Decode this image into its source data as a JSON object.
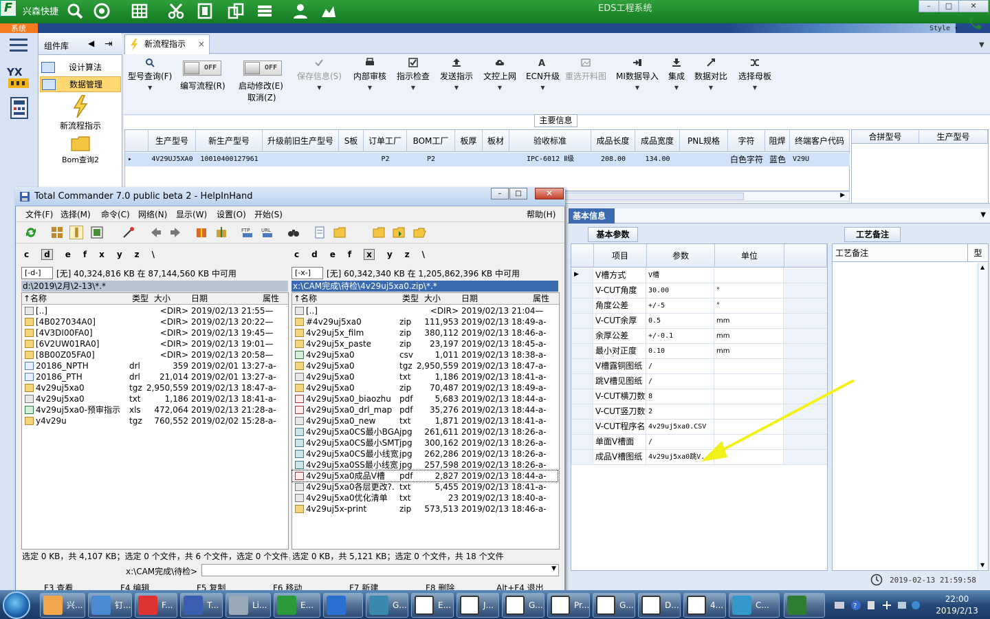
{
  "app": {
    "name": "兴森快捷",
    "title": "EDS工程系统",
    "system_tab": "系统",
    "style_label": "Style ▾"
  },
  "window_buttons": [
    "–",
    "□",
    "✕"
  ],
  "nav": {
    "comp_lib": "组件库",
    "items": [
      "设计算法",
      "数据管理"
    ],
    "big_items": [
      "新流程指示",
      "Bom查询2"
    ]
  },
  "doc_tab": {
    "label": "新流程指示",
    "close": "×"
  },
  "ribbon": {
    "type_query": "型号查询(F)",
    "write_flow": "编写流程(R)",
    "write_flow_state": "OFF",
    "start_edit": "启动修改(E)",
    "start_edit_state": "OFF",
    "cancel": "取消(Z)",
    "save_info": "保存信息(S)",
    "internal_review": "内部审核",
    "indicate_check": "指示检查",
    "send_indicate": "发送指示",
    "upload_doc": "文控上网",
    "ecn_upgrade": "ECN升级",
    "reselect_material": "重选开料图",
    "mi_import": "MI数据导入",
    "integrate": "集成",
    "data_compare": "数据对比",
    "select_mother": "选择母板"
  },
  "main_info": {
    "label": "主要信息",
    "headers": [
      "生产型号",
      "新生产型号",
      "升级前旧生产型号",
      "S板",
      "订单工厂",
      "BOM工厂",
      "板厚",
      "板材",
      "验收标准",
      "成品长度",
      "成品宽度",
      "PNL规格",
      "字符",
      "阻焊",
      "终端客户代码"
    ],
    "row": [
      "4V29UJ5XA0",
      "10010400127961",
      "",
      "",
      "P2",
      "P2",
      "",
      "",
      "IPC-6012 Ⅱ级",
      "208.00",
      "134.00",
      "",
      "白色字符",
      "蓝色",
      "V29U"
    ],
    "side_headers": [
      "合拼型号",
      "生产型号"
    ]
  },
  "basic_info": {
    "tab": "基本信息",
    "param_tab": "基本参数",
    "headers": [
      "项目",
      "参数",
      "单位"
    ],
    "rows": [
      {
        "item": "V槽方式",
        "value": "V槽",
        "unit": ""
      },
      {
        "item": "V-CUT角度",
        "value": "30.00",
        "unit": "°"
      },
      {
        "item": "角度公差",
        "value": "+/-5",
        "unit": "°"
      },
      {
        "item": "V-CUT余厚",
        "value": "0.5",
        "unit": "mm"
      },
      {
        "item": "余厚公差",
        "value": "+/-0.1",
        "unit": "mm"
      },
      {
        "item": "最小对正度",
        "value": "0.10",
        "unit": "mm"
      },
      {
        "item": "V槽露铜图纸",
        "value": "/",
        "unit": ""
      },
      {
        "item": "跳V槽见图纸",
        "value": "/",
        "unit": ""
      },
      {
        "item": "V-CUT横刀数",
        "value": "8",
        "unit": ""
      },
      {
        "item": "V-CUT竖刀数",
        "value": "2",
        "unit": ""
      },
      {
        "item": "V-CUT程序名",
        "value": "4v29uj5xa0.CSV",
        "unit": ""
      },
      {
        "item": "单面V槽面",
        "value": "/",
        "unit": ""
      },
      {
        "item": "成品V槽图纸",
        "value": "4v29uj5xa0跳V...",
        "unit": ""
      }
    ],
    "craft_tab": "工艺备注",
    "craft_header": "工艺备注",
    "type_header": "型",
    "datetime": "2019-02-13 21:59:58"
  },
  "tc": {
    "title": "Total Commander 7.0 public beta 2 - HelpInHand",
    "menu": [
      "文件(F)",
      "选择(M)",
      "命令(C)",
      "网络(N)",
      "显示(W)",
      "设置(O)",
      "开始(S)"
    ],
    "help": "帮助(H)",
    "left": {
      "drives": [
        "c",
        "d",
        "e",
        "f",
        "x",
        "y",
        "z",
        "\\"
      ],
      "drive_sel": "[-d-]",
      "info": "[无] 40,324,816 KB 在 87,144,560 KB 中可用",
      "path": "d:\\2019\\2月\\2-13\\*.*",
      "headers": [
        "↑名称",
        "类型",
        "大小",
        "日期",
        "属性"
      ],
      "files": [
        {
          "n": "[..]",
          "t": "",
          "s": "<DIR>",
          "d": "2019/02/13 21:55—",
          "k": "u"
        },
        {
          "n": "[4B027034A0]",
          "t": "",
          "s": "<DIR>",
          "d": "2019/02/13 20:22—",
          "k": "f"
        },
        {
          "n": "[4V3DI00FA0]",
          "t": "",
          "s": "<DIR>",
          "d": "2019/02/13 19:45—",
          "k": "f"
        },
        {
          "n": "[6V2UW01RA0]",
          "t": "",
          "s": "<DIR>",
          "d": "2019/02/13 19:01—",
          "k": "f"
        },
        {
          "n": "[8B00Z05FA0]",
          "t": "",
          "s": "<DIR>",
          "d": "2019/02/13 20:58—",
          "k": "f"
        },
        {
          "n": "20186_NPTH",
          "t": "drl",
          "s": "359",
          "d": "2019/02/01 13:27-a-",
          "k": "d"
        },
        {
          "n": "20186_PTH",
          "t": "drl",
          "s": "21,014",
          "d": "2019/02/01 13:27-a-",
          "k": "d"
        },
        {
          "n": "4v29uj5xa0",
          "t": "tgz",
          "s": "2,950,559",
          "d": "2019/02/13 18:47-a-",
          "k": "f"
        },
        {
          "n": "4v29uj5xa0",
          "t": "txt",
          "s": "1,186",
          "d": "2019/02/13 18:41-a-",
          "k": "u"
        },
        {
          "n": "4v29uj5xa0-预审指示",
          "t": "xls",
          "s": "472,064",
          "d": "2019/02/13 21:28-a-",
          "k": "x"
        },
        {
          "n": "y4v29u",
          "t": "tgz",
          "s": "760,552",
          "d": "2019/02/02 15:28-a-",
          "k": "f"
        }
      ]
    },
    "right": {
      "drives": [
        "c",
        "d",
        "e",
        "f",
        "x",
        "y",
        "z",
        "\\"
      ],
      "drive_sel": "[-x-]",
      "info": "[无] 60,342,340 KB 在 1,205,862,396 KB 中可用",
      "path": "x:\\CAM完成\\待检\\4v29uj5xa0.zip\\*.*",
      "headers": [
        "↑名称",
        "类型",
        "大小",
        "日期",
        "属性"
      ],
      "files": [
        {
          "n": "[..]",
          "t": "",
          "s": "<DIR>",
          "d": "2019/02/13 21:04—",
          "k": "u"
        },
        {
          "n": "#4v29uj5xa0",
          "t": "zip",
          "s": "111,953",
          "d": "2019/02/13 18:49-a-",
          "k": "f"
        },
        {
          "n": "4v29uj5x_film",
          "t": "zip",
          "s": "380,112",
          "d": "2019/02/13 18:46-a-",
          "k": "f"
        },
        {
          "n": "4v29uj5x_paste",
          "t": "zip",
          "s": "23,197",
          "d": "2019/02/13 18:45-a-",
          "k": "f"
        },
        {
          "n": "4v29uj5xa0",
          "t": "csv",
          "s": "1,011",
          "d": "2019/02/13 18:38-a-",
          "k": "x"
        },
        {
          "n": "4v29uj5xa0",
          "t": "tgz",
          "s": "2,950,559",
          "d": "2019/02/13 18:47-a-",
          "k": "f"
        },
        {
          "n": "4v29uj5xa0",
          "t": "txt",
          "s": "1,186",
          "d": "2019/02/13 18:41-a-",
          "k": "u"
        },
        {
          "n": "4v29uj5xa0",
          "t": "zip",
          "s": "70,487",
          "d": "2019/02/13 18:49-a-",
          "k": "f"
        },
        {
          "n": "4v29uj5xa0_biaozhu",
          "t": "pdf",
          "s": "5,683",
          "d": "2019/02/13 18:44-a-",
          "k": "p"
        },
        {
          "n": "4v29uj5xa0_drl_map",
          "t": "pdf",
          "s": "35,276",
          "d": "2019/02/13 18:44-a-",
          "k": "p"
        },
        {
          "n": "4v29uj5xa0_new",
          "t": "txt",
          "s": "1,871",
          "d": "2019/02/13 18:41-a-",
          "k": "u"
        },
        {
          "n": "4v29uj5xa0CS最小BGA",
          "t": "jpg",
          "s": "261,611",
          "d": "2019/02/13 18:26-a-",
          "k": "j"
        },
        {
          "n": "4v29uj5xa0CS最小SMT",
          "t": "jpg",
          "s": "300,162",
          "d": "2019/02/13 18:26-a-",
          "k": "j"
        },
        {
          "n": "4v29uj5xa0CS最小线宽",
          "t": "jpg",
          "s": "262,286",
          "d": "2019/02/13 18:26-a-",
          "k": "j"
        },
        {
          "n": "4v29uj5xa0SS最小线宽",
          "t": "jpg",
          "s": "257,598",
          "d": "2019/02/13 18:26-a-",
          "k": "j"
        },
        {
          "n": "4v29uj5xa0成品V槽",
          "t": "pdf",
          "s": "2,827",
          "d": "2019/02/13 18:44-a-",
          "k": "p"
        },
        {
          "n": "4v29uj5xa0各层更改?.",
          "t": "txt",
          "s": "5,455",
          "d": "2019/02/13 18:41-a-",
          "k": "u"
        },
        {
          "n": "4v29uj5xa0优化清单",
          "t": "txt",
          "s": "23",
          "d": "2019/02/13 18:40-a-",
          "k": "u"
        },
        {
          "n": "4v29uj5x-print",
          "t": "zip",
          "s": "573,513",
          "d": "2019/02/13 18:46-a-",
          "k": "f"
        }
      ]
    },
    "status_left": "选定 0 KB，共 4,107 KB；选定 0 个文件，共 6 个文件，选定 0 个文件，共",
    "status_right": "选定 0 KB，共 5,121 KB；选定 0 个文件，共 18 个文件",
    "cmd_path": "x:\\CAM完成\\待检>",
    "fkeys": [
      "F3 查看",
      "F4 编辑",
      "F5 复制",
      "F6 移动",
      "F7 新建",
      "F8 删除",
      "Alt+F4 退出"
    ]
  },
  "taskbar": {
    "items": [
      "兴...",
      "钉...",
      "F...",
      "T...",
      "Li...",
      "E...",
      "",
      "G...",
      "E...",
      "J...",
      "G...",
      "Pr...",
      "G...",
      "D...",
      "4...",
      "C...",
      ""
    ],
    "time": "22:00",
    "date": "2019/2/13"
  },
  "colors": {
    "accent": "#3a6ab0",
    "green": "#1f8a2c",
    "highlight": "#ffd871",
    "arrow": "#f2f21a"
  }
}
